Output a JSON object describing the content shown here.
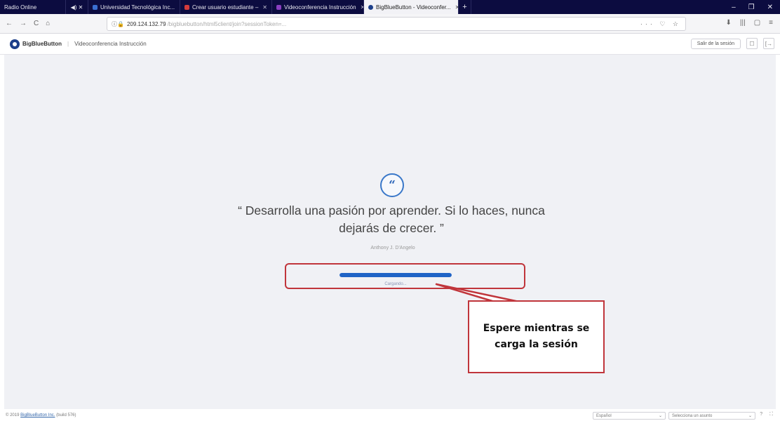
{
  "browser": {
    "tabs": [
      {
        "label": "Radio Online",
        "favicon_color": "#0c0c40"
      },
      {
        "label": "Universidad Tecnológica Inc...",
        "favicon_color": "#3a6fd0"
      },
      {
        "label": "Crear usuario estudiante –",
        "favicon_color": "#d43b3b"
      },
      {
        "label": "Videoconferencia Instrucción",
        "favicon_color": "#8a3fc0"
      },
      {
        "label": "BigBlueButton - Videoconfer...",
        "favicon_color": "#1d3f8a"
      }
    ],
    "media_label": "◀︎) ✕",
    "new_tab": "+",
    "window_controls": [
      "–",
      "❐",
      "✕"
    ],
    "url_host": "209.124.132.79",
    "url_path": "/bigbluebutton/html5client/join?sessionToken=...",
    "url_icons": "··· ♡ ☆",
    "toolbar_icons": [
      "⬇",
      "|||",
      "▢",
      "≡"
    ],
    "nav_buttons": [
      "←",
      "→",
      "C",
      "⌂"
    ]
  },
  "app_header": {
    "brand": "BigBlueButton",
    "session_title": "Videoconferencia Instrucción",
    "exit_button": "Salir de la sesión",
    "icon_buttons": [
      "☐",
      "[→"
    ]
  },
  "loading": {
    "quote_mark": "“",
    "quote": "“ Desarrolla una pasión por aprender. Si lo haces, nunca dejarás de crecer. ”",
    "author": "Anthony J. D'Angelo",
    "progress": 1.0,
    "label": "Cargando..."
  },
  "annotation": {
    "text": "Espere mientras se carga la sesión",
    "color": "#c0353b"
  },
  "footer": {
    "copyright": "© 2019 ",
    "company": "BigBlueButton Inc.",
    "version": " (build 576)",
    "language": "Español",
    "issue": "Selecciona un asunto",
    "icons": "? ⛶"
  }
}
